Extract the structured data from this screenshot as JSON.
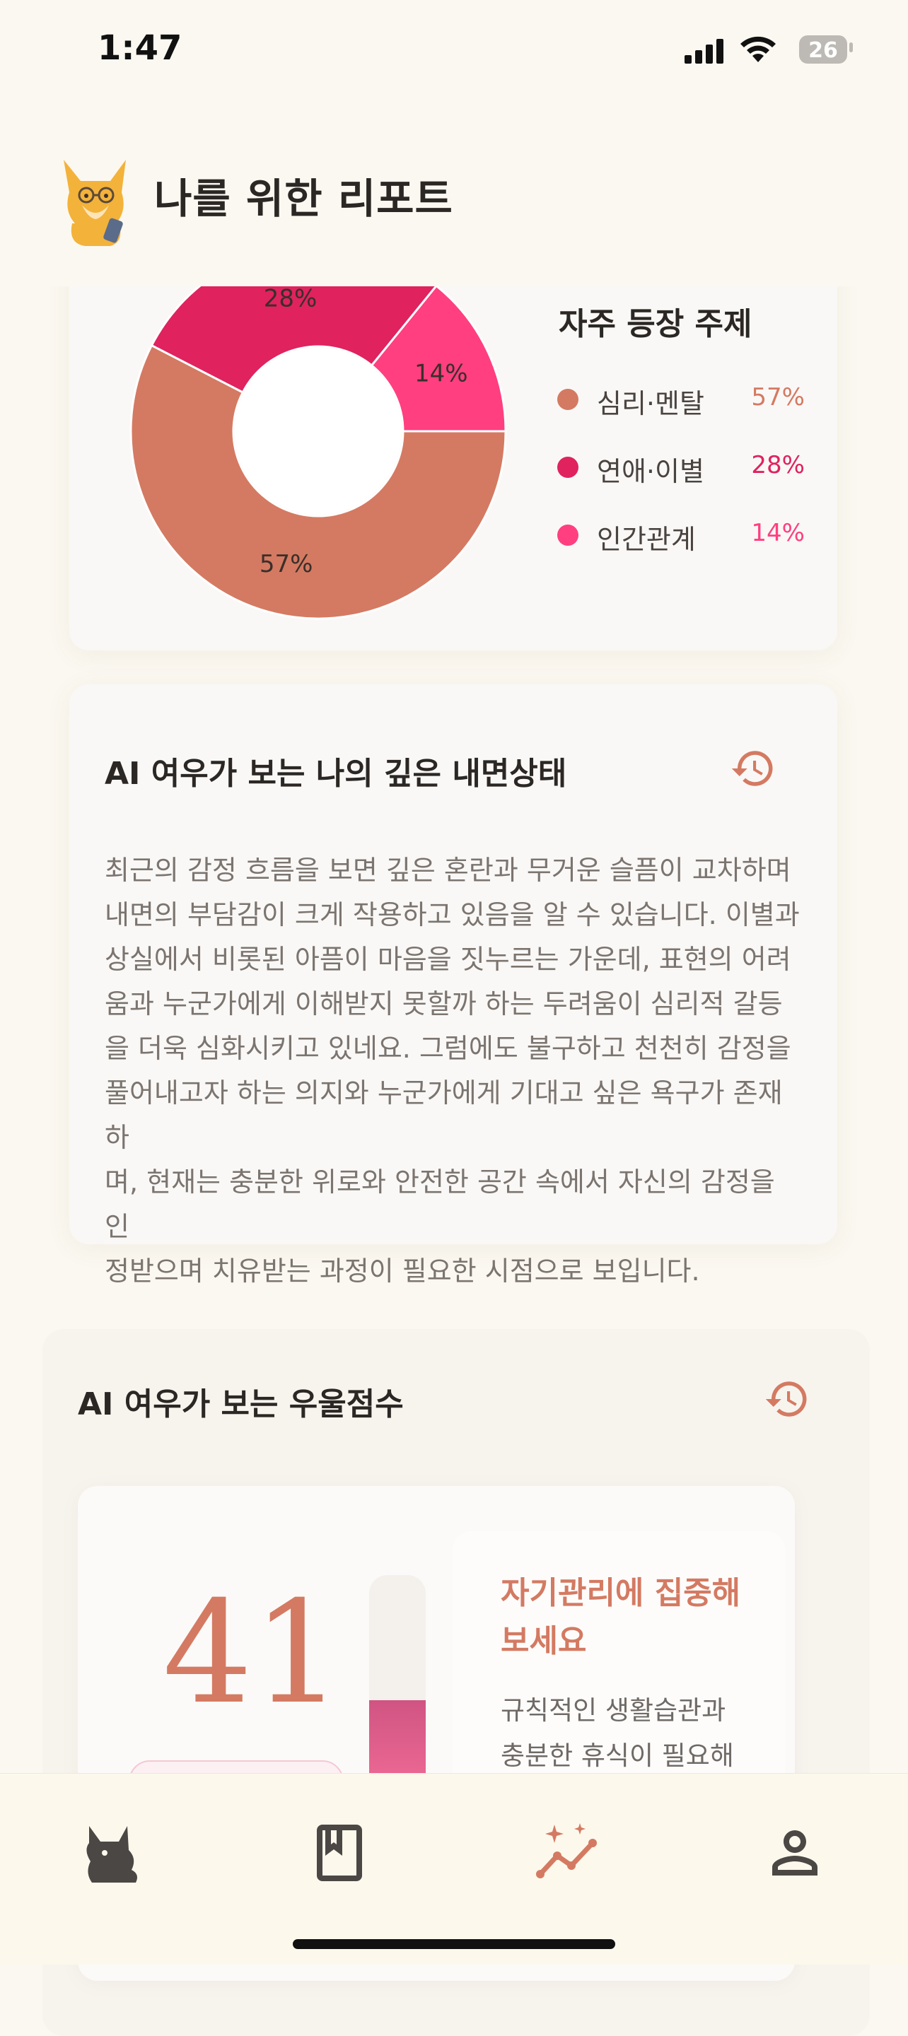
{
  "status_bar": {
    "time": "1:47",
    "battery": "26"
  },
  "header": {
    "title": "나를 위한 리포트",
    "logo_icon": "fox-reading-phone-icon"
  },
  "topics_card": {
    "legend_title": "자주 등장 주제",
    "items": [
      {
        "label": "심리·멘탈",
        "value": "57%",
        "color": "#d47a62"
      },
      {
        "label": "연애·이별",
        "value": "28%",
        "color": "#e0225f"
      },
      {
        "label": "인간관계",
        "value": "14%",
        "color": "#ff3f80"
      }
    ]
  },
  "chart_data": {
    "type": "pie",
    "categories": [
      "심리·멘탈",
      "연애·이별",
      "인간관계"
    ],
    "values": [
      57,
      28,
      14
    ],
    "labels": [
      "57%",
      "28%",
      "14%"
    ],
    "colors": [
      "#d47a62",
      "#e0225f",
      "#ff3f80"
    ],
    "title": "자주 등장 주제",
    "legend": "right"
  },
  "inner_state_card": {
    "title": "AI 여우가 보는 나의 깊은 내면상태",
    "history_icon": "history-icon",
    "lines": [
      "최근의 감정 흐름을 보면 깊은 혼란과 무거운 슬픔이 교차하며",
      "내면의 부담감이 크게 작용하고 있음을 알 수 있습니다. 이별과",
      "상실에서 비롯된 아픔이 마음을 짓누르는 가운데, 표현의 어려",
      "움과 누군가에게 이해받지 못할까 하는 두려움이 심리적 갈등",
      "을 더욱 심화시키고 있네요. 그럼에도 불구하고 천천히 감정을",
      "풀어내고자 하는 의지와 누군가에게 기대고 싶은 욕구가 존재하",
      "며, 현재는 충분한 위로와 안전한 공간 속에서 자신의 감정을 인",
      "정받으며 치유받는 과정이 필요한 시점으로 보입니다."
    ]
  },
  "depression_card": {
    "title": "AI 여우가 보는 우울점수",
    "history_icon": "history-icon",
    "score": "41",
    "score_level": 0.41,
    "advice_title_lines": [
      "자기관리에 집중해",
      "보세요"
    ],
    "advice_lines": [
      "규칙적인 생활습관과",
      "충분한 휴식이 필요해"
    ]
  },
  "tab_bar": {
    "tabs": [
      {
        "icon": "fox-home-icon",
        "active": false
      },
      {
        "icon": "book-icon",
        "active": false
      },
      {
        "icon": "sparkle-chart-icon",
        "active": true
      },
      {
        "icon": "profile-icon",
        "active": false
      }
    ],
    "active_color": "#d47a62",
    "inactive_color": "#4a4745"
  }
}
